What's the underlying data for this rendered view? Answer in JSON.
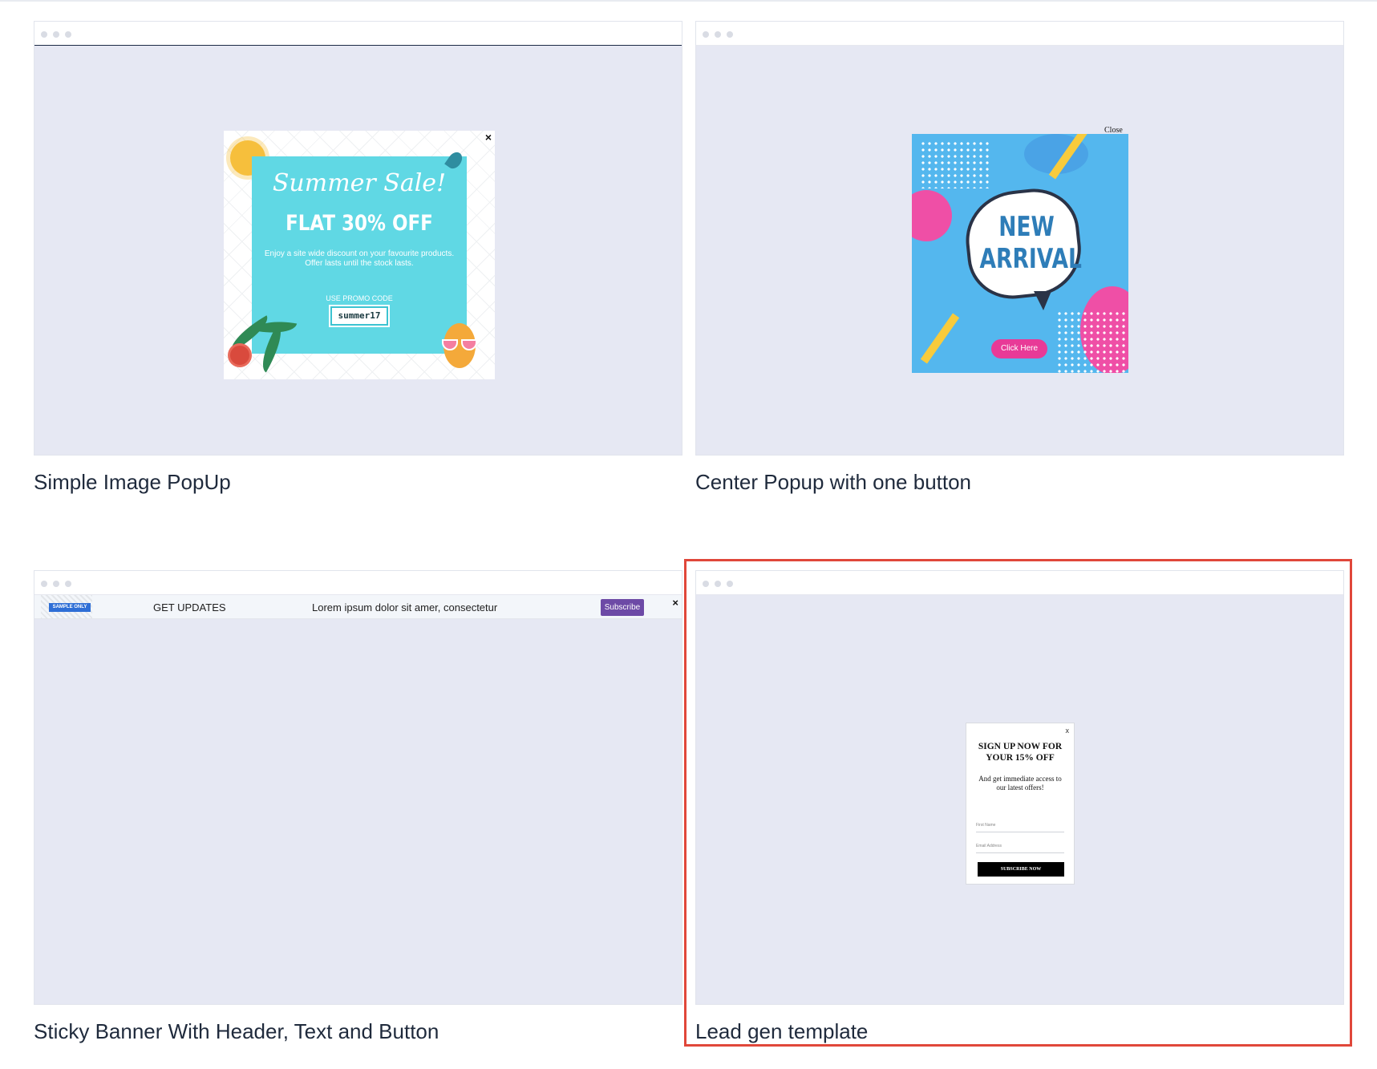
{
  "cards": [
    {
      "caption": "Simple Image PopUp",
      "preview": {
        "script_title": "Summer Sale!",
        "headline": "FLAT 30% OFF",
        "description": "Enjoy a site wide discount on your favourite products. Offer lasts until the stock lasts.",
        "promo_label": "USE PROMO CODE",
        "promo_code": "summer17",
        "close_glyph": "×"
      }
    },
    {
      "caption": "Center Popup with one button",
      "preview": {
        "close_label": "Close",
        "title_line1": "NEW",
        "title_line2": "ARRIVAL",
        "button_label": "Click Here"
      }
    },
    {
      "caption": "Sticky Banner With Header, Text and Button",
      "preview": {
        "ribbon_label": "SAMPLE ONLY",
        "header": "GET UPDATES",
        "text": "Lorem ipsum dolor sit amer, consectetur",
        "button_label": "Subscribe",
        "close_glyph": "×"
      }
    },
    {
      "caption": "Lead gen template",
      "selected": true,
      "preview": {
        "close_glyph": "x",
        "heading": "SIGN UP NOW FOR YOUR 15% OFF",
        "body": "And get immediate access to our latest offers!",
        "field1_placeholder": "First Name",
        "field2_placeholder": "Email Address",
        "button_label": "SUBSCRIBE NOW"
      }
    }
  ],
  "colors": {
    "preview_bg": "#e6e8f3",
    "selection_border": "#e0473a",
    "caption_text": "#1f2a3c",
    "summer_panel": "#60d8e4",
    "arrival_bg": "#54b7ee",
    "arrival_button": "#e83a97",
    "banner_button": "#6d4aa6"
  },
  "icons": [
    "window-dots-icon",
    "close-icon",
    "sun-icon",
    "pineapple-icon",
    "speech-bubble-icon"
  ]
}
